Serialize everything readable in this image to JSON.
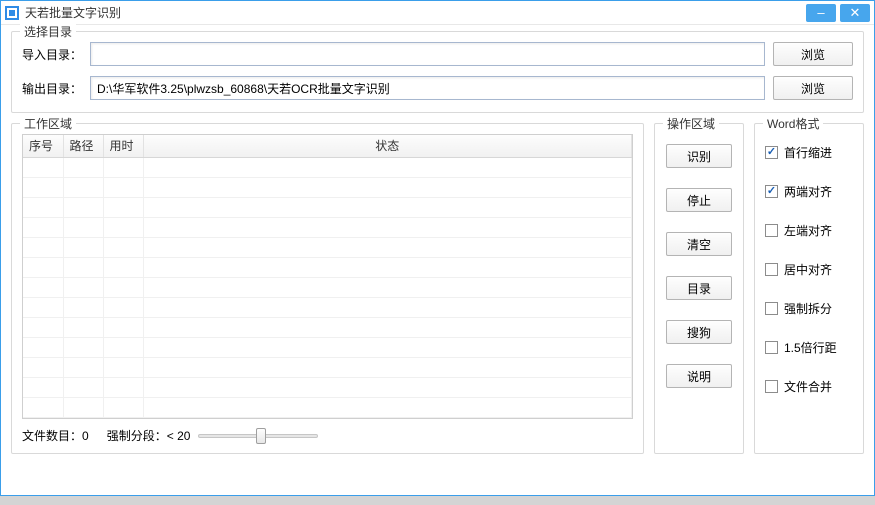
{
  "title": "天若批量文字识别",
  "directory_section": {
    "legend": "选择目录",
    "import_label": "导入目录：",
    "import_value": "",
    "output_label": "输出目录：",
    "output_value": "D:\\华军软件3.25\\plwzsb_60868\\天若OCR批量文字识别",
    "browse_label": "浏览"
  },
  "work_section": {
    "legend": "工作区域",
    "columns": {
      "seq": "序号",
      "path": "路径",
      "time": "用时",
      "status": "状态"
    },
    "file_count_label": "文件数目：",
    "file_count_value": "0",
    "force_split_label": "强制分段：",
    "force_split_op": "<",
    "force_split_value": "20"
  },
  "ops_section": {
    "legend": "操作区域",
    "buttons": {
      "recognize": "识别",
      "stop": "停止",
      "clear": "清空",
      "directory": "目录",
      "sogou": "搜狗",
      "help": "说明"
    }
  },
  "word_section": {
    "legend": "Word格式",
    "options": {
      "first_indent": "首行缩进",
      "justify": "两端对齐",
      "left_align": "左端对齐",
      "center_align": "居中对齐",
      "force_break": "强制拆分",
      "line_spacing": "1.5倍行距",
      "file_merge": "文件合并"
    }
  }
}
